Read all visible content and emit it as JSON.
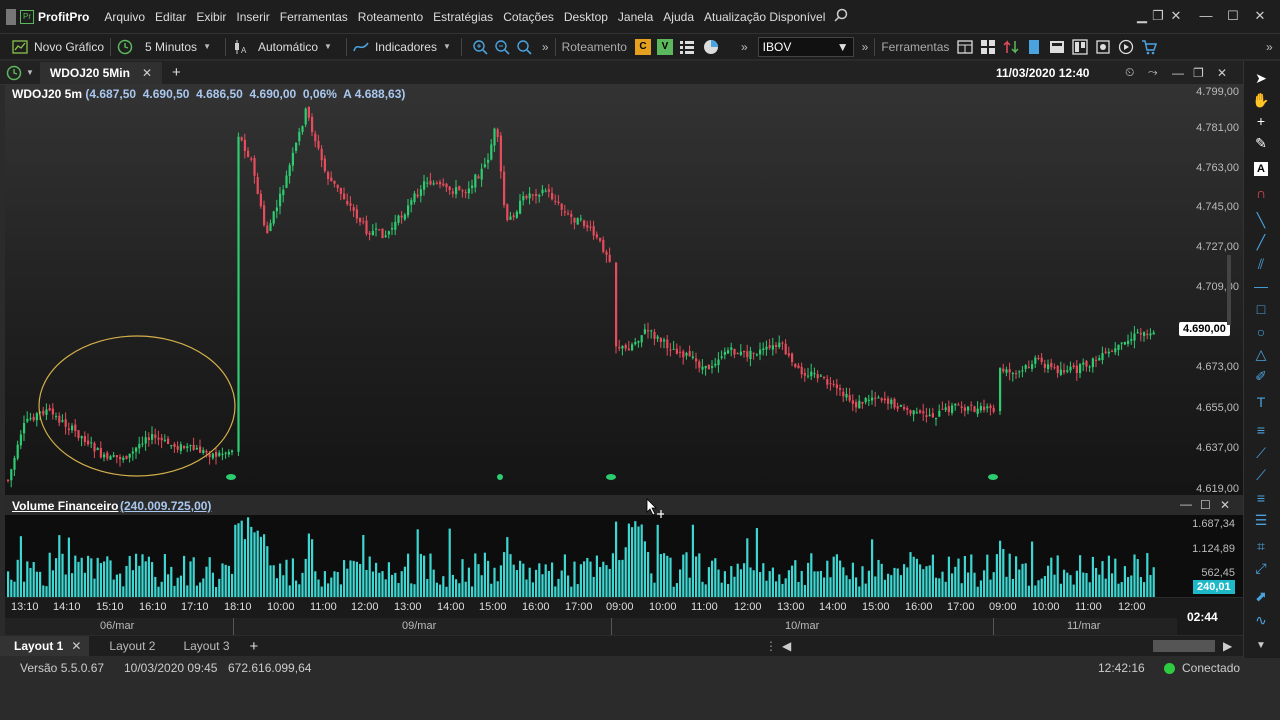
{
  "app": {
    "name": "ProfitPro",
    "menu": [
      "Arquivo",
      "Editar",
      "Exibir",
      "Inserir",
      "Ferramentas",
      "Roteamento",
      "Estratégias",
      "Cotações",
      "Desktop",
      "Janela",
      "Ajuda",
      "Atualização Disponível"
    ]
  },
  "toolbar": {
    "new_chart": "Novo Gráfico",
    "interval": "5 Minutos",
    "mode": "Automático",
    "indicators": "Indicadores",
    "routing": "Roteamento",
    "routing_c": "C",
    "routing_v": "V",
    "symbol_value": "IBOV",
    "tools": "Ferramentas"
  },
  "tabs": [
    {
      "label": "WDOJ20 5Min"
    }
  ],
  "chart_header": {
    "datetime": "11/03/2020 12:40",
    "symbol": "WDOJ20 5m",
    "ohlc": "(4.687,50  4.690,50  4.686,50  4.690,00  0,06%  A 4.688,63)"
  },
  "price_axis": {
    "labels": [
      "4.799,00",
      "4.781,00",
      "4.763,00",
      "4.745,00",
      "4.727,00",
      "4.709,00",
      "4.673,00",
      "4.655,00",
      "4.637,00",
      "4.619,00"
    ],
    "current": "4.690,00"
  },
  "volume": {
    "title": "Volume Financeiro",
    "value": "(240.009.725,00)",
    "axis_labels": [
      "1.687,34",
      "1.124,89",
      "562,45"
    ],
    "current": "240,01"
  },
  "time_axis": {
    "labels": [
      "13:10",
      "14:10",
      "15:10",
      "16:10",
      "17:10",
      "18:10",
      "10:00",
      "11:00",
      "12:00",
      "13:00",
      "14:00",
      "15:00",
      "16:00",
      "17:00",
      "09:00",
      "10:00",
      "11:00",
      "12:00",
      "13:00",
      "14:00",
      "15:00",
      "16:00",
      "17:00",
      "09:00",
      "10:00",
      "11:00",
      "12:00"
    ],
    "countdown": "02:44"
  },
  "date_axis": {
    "labels": [
      "06/mar",
      "09/mar",
      "10/mar",
      "11/mar"
    ]
  },
  "layouts": [
    "Layout 1",
    "Layout 2",
    "Layout 3"
  ],
  "status": {
    "version": "Versão 5.5.0.67",
    "date": "10/03/2020 09:45",
    "value": "672.616.099,64",
    "clock": "12:42:16",
    "connection": "Conectado"
  },
  "colors": {
    "up": "#2ecc71",
    "down": "#e74c5c",
    "volume": "#3dd6d0",
    "accent": "#4aa3df",
    "circle": "#d4b04a"
  }
}
